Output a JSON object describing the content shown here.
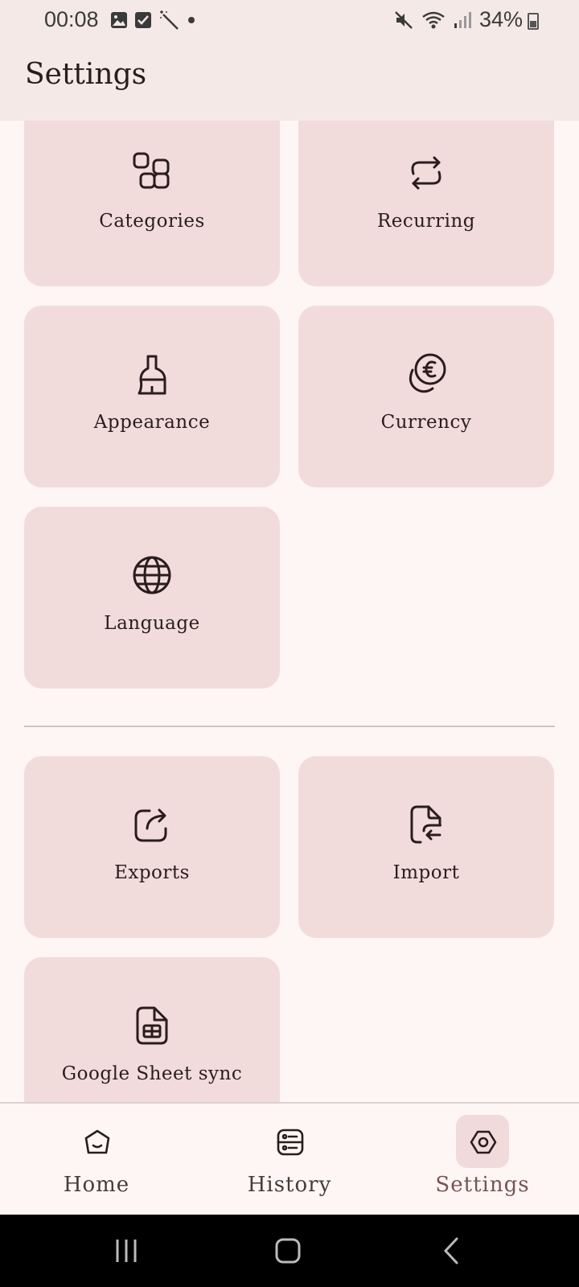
{
  "status_bar": {
    "time": "00:08",
    "battery": "34%",
    "left_icons": [
      "gallery-icon",
      "check-box-icon",
      "magic-wand-icon",
      "dot-icon"
    ],
    "right_icons": [
      "mute-icon",
      "wifi-icon",
      "signal-icon",
      "battery-icon"
    ]
  },
  "header": {
    "title": "Settings"
  },
  "tiles_group1": [
    {
      "label": "Categories",
      "icon": "categories-icon"
    },
    {
      "label": "Recurring",
      "icon": "recurring-icon"
    },
    {
      "label": "Appearance",
      "icon": "brush-icon"
    },
    {
      "label": "Currency",
      "icon": "euro-coins-icon"
    },
    {
      "label": "Language",
      "icon": "globe-icon"
    }
  ],
  "tiles_group2": [
    {
      "label": "Exports",
      "icon": "share-icon"
    },
    {
      "label": "Import",
      "icon": "file-import-icon"
    },
    {
      "label": "Google Sheet sync",
      "icon": "spreadsheet-icon"
    }
  ],
  "bottom_nav": [
    {
      "label": "Home",
      "icon": "home-icon",
      "active": false
    },
    {
      "label": "History",
      "icon": "history-list-icon",
      "active": false
    },
    {
      "label": "Settings",
      "icon": "settings-hexagon-icon",
      "active": true
    }
  ],
  "system_nav": [
    "recents-icon",
    "home-button-icon",
    "back-icon"
  ],
  "colors": {
    "tile": "#f1dcdb",
    "background": "#fdf6f4",
    "header": "#f5e9e7",
    "active_nav": "#f0dada"
  }
}
